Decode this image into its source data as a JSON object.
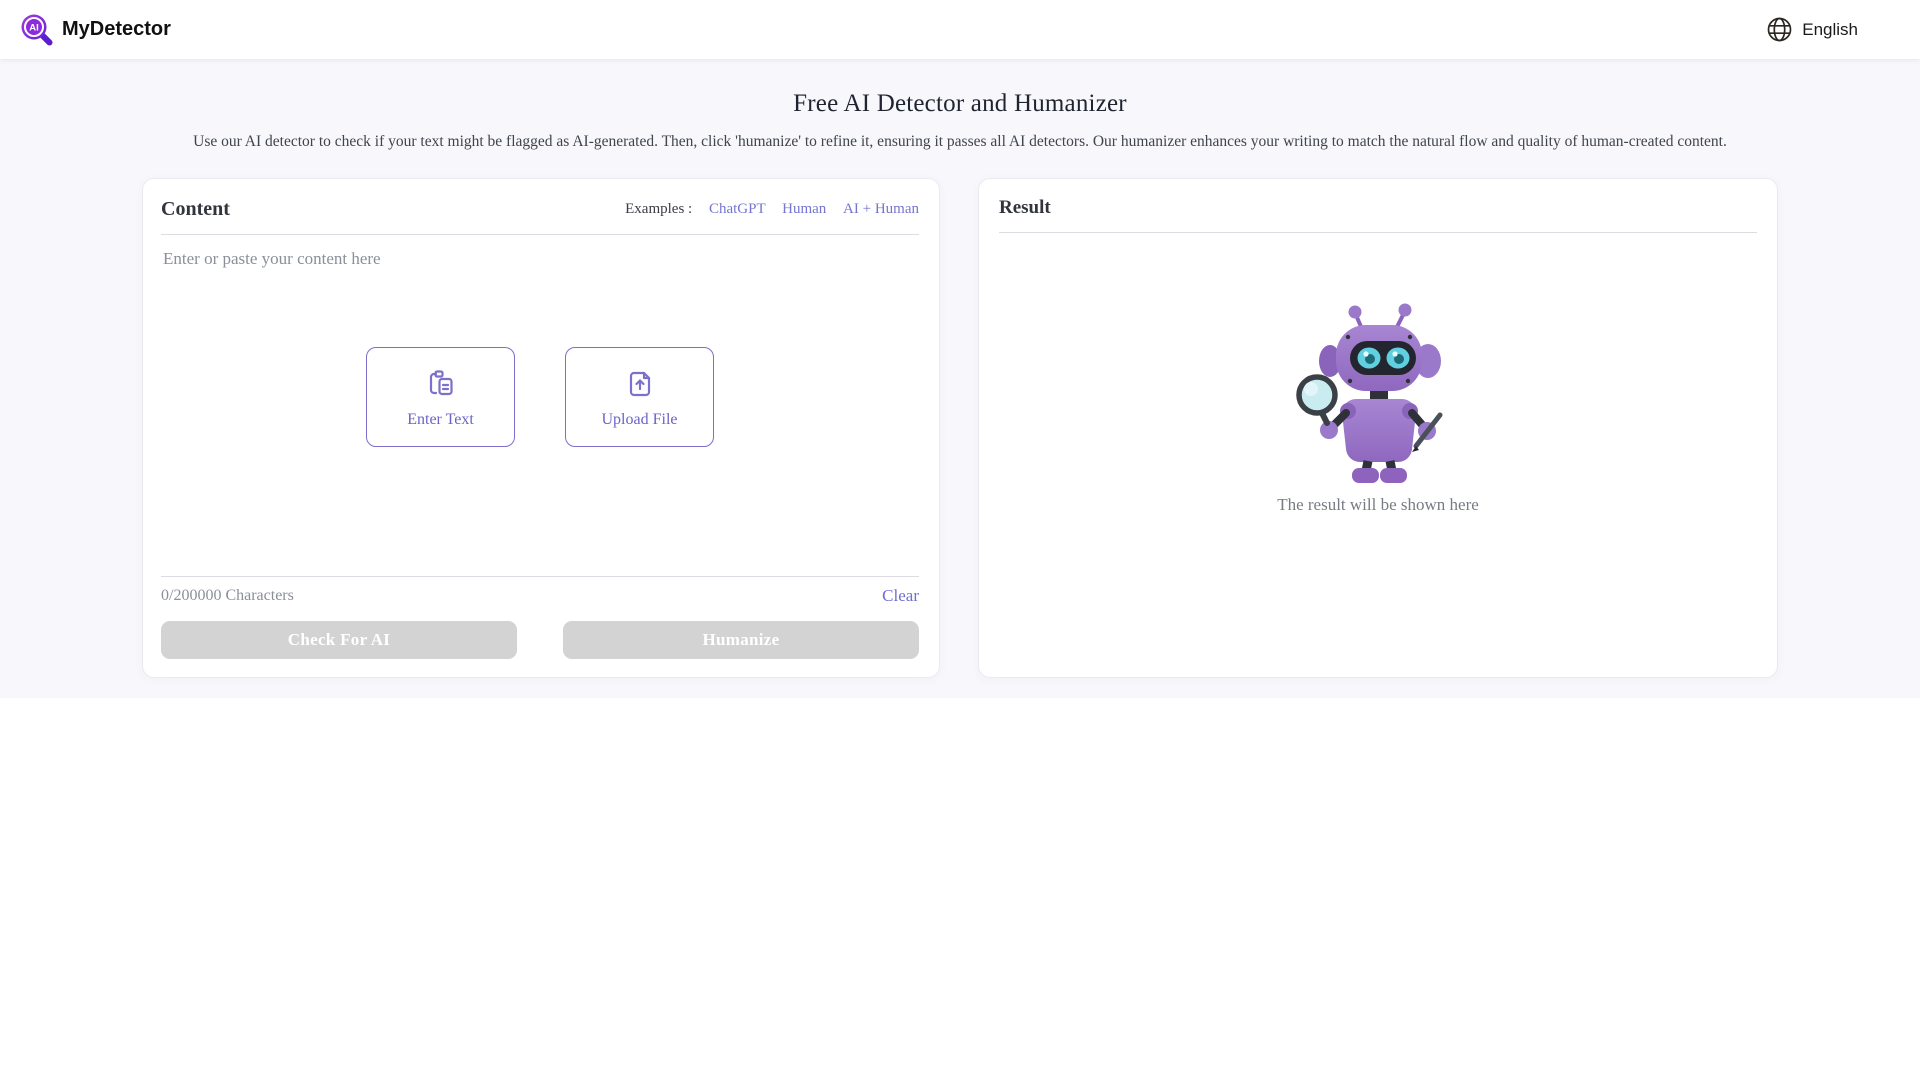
{
  "header": {
    "brand": "MyDetector",
    "language": "English"
  },
  "hero": {
    "title": "Free AI Detector and Humanizer",
    "subtitle": "Use our AI detector to check if your text might be flagged as AI-generated. Then, click 'humanize' to refine it, ensuring it passes all AI detectors. Our humanizer enhances your writing to match the natural flow and quality of human-created content."
  },
  "content_card": {
    "title": "Content",
    "examples_label": "Examples :",
    "examples": [
      {
        "label": "ChatGPT"
      },
      {
        "label": "Human"
      },
      {
        "label": "AI + Human"
      }
    ],
    "placeholder": "Enter or paste your content here",
    "enter_text_label": "Enter Text",
    "upload_file_label": "Upload File",
    "char_count": "0/200000 Characters",
    "clear_label": "Clear",
    "check_ai_label": "Check For AI",
    "humanize_label": "Humanize"
  },
  "result_card": {
    "title": "Result",
    "empty_text": "The result will be shown here"
  },
  "icons": {
    "logo": "ai-magnifier",
    "language": "globe",
    "enter_text": "clipboard-paste",
    "upload_file": "file-upload",
    "mascot": "purple-detective-robot"
  },
  "colors": {
    "accent_purple": "#7b70cb",
    "link_purple": "#7575d2",
    "disabled_button_bg": "#d3d3d3",
    "page_background": "#f8f8fc",
    "robot_body": "#9b79ca",
    "robot_eyes": "#62cfe0"
  }
}
